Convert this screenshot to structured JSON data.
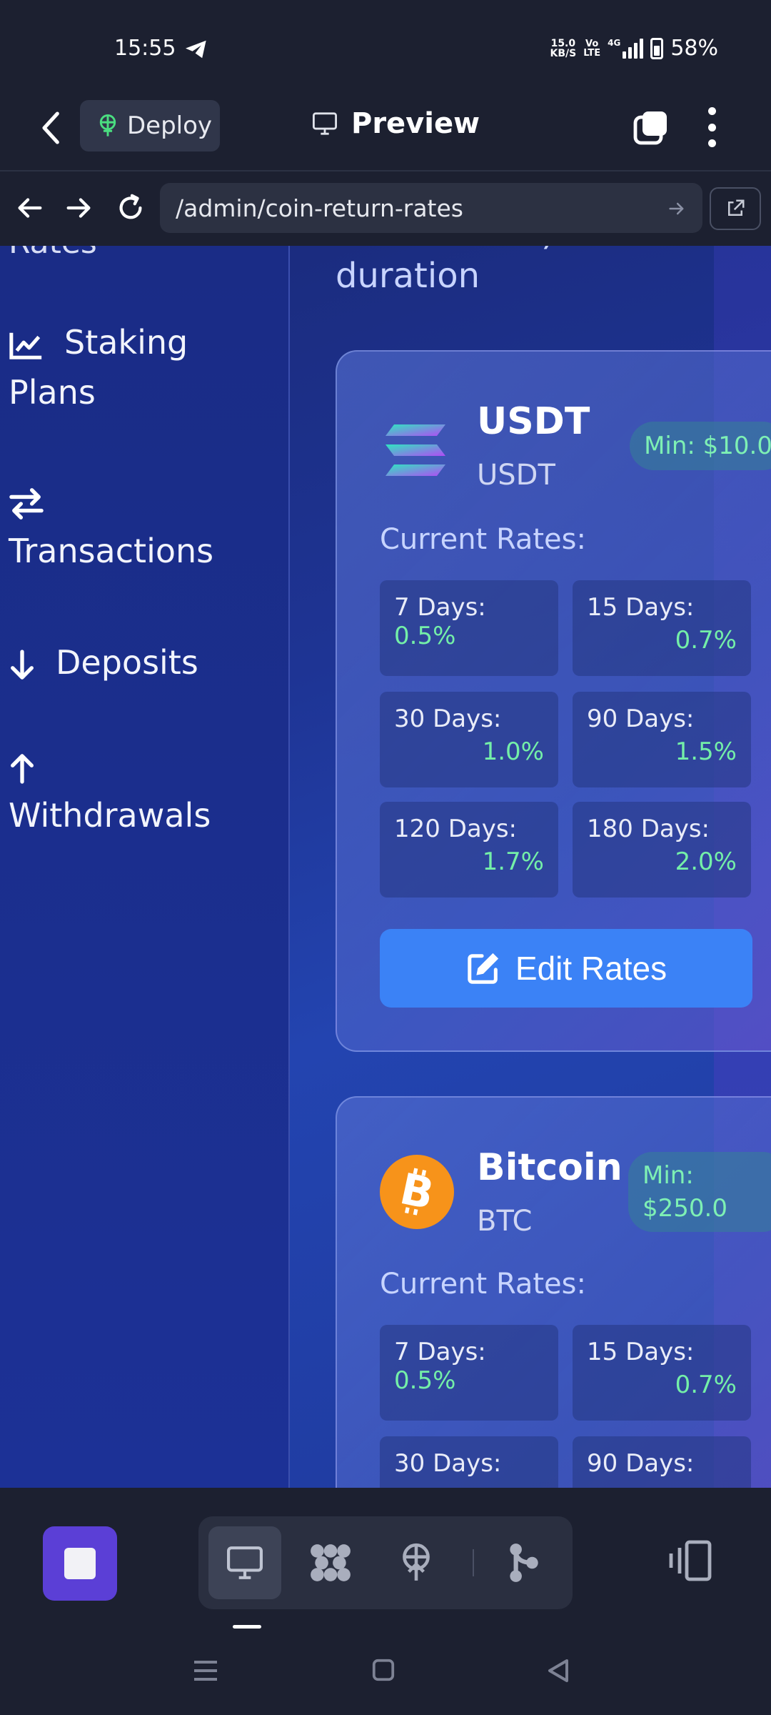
{
  "status_bar": {
    "time": "15:55",
    "net_speed_value": "15.0",
    "net_speed_unit": "KB/S",
    "volte_top": "Vo",
    "volte_bottom": "LTE",
    "network": "4G",
    "battery": "58%"
  },
  "app_bar": {
    "deploy_label": "Deploy",
    "title": "Preview"
  },
  "url_bar": {
    "url": "/admin/coin-return-rates"
  },
  "sidebar": {
    "partial_top": "Rates",
    "items": [
      {
        "label_line1": "Staking",
        "label_line2": "Plans",
        "icon": "chart-line-icon"
      },
      {
        "label": "Transactions",
        "icon": "swap-arrows-icon"
      },
      {
        "label": "Deposits",
        "icon": "arrow-down-icon"
      },
      {
        "label": "Withdrawals",
        "icon": "arrow-up-icon"
      }
    ]
  },
  "main": {
    "intro_fragment": ")",
    "intro_text": "duration",
    "cards": [
      {
        "name": "USDT",
        "symbol": "USDT",
        "min_label": "Min: $10.0",
        "rates_heading": "Current Rates:",
        "rates": [
          {
            "label": "7 Days:",
            "value": "0.5%"
          },
          {
            "label": "15 Days:",
            "value": "0.7%"
          },
          {
            "label": "30 Days:",
            "value": "1.0%"
          },
          {
            "label": "90 Days:",
            "value": "1.5%"
          },
          {
            "label": "120 Days:",
            "value": "1.7%"
          },
          {
            "label": "180 Days:",
            "value": "2.0%"
          }
        ],
        "edit_label": "Edit Rates"
      },
      {
        "name": "Bitcoin",
        "symbol": "BTC",
        "min_line1": "Min:",
        "min_line2": "$250.0",
        "rates_heading": "Current Rates:",
        "rates": [
          {
            "label": "7 Days:",
            "value": "0.5%"
          },
          {
            "label": "15 Days:",
            "value": "0.7%"
          },
          {
            "label": "30 Days:",
            "value": ""
          },
          {
            "label": "90 Days:",
            "value": ""
          }
        ]
      }
    ]
  },
  "colors": {
    "accent_blue": "#3b82f6",
    "rate_green": "#74efa8",
    "stop_purple": "#5b3fd6",
    "bitcoin_orange": "#f7931a"
  }
}
